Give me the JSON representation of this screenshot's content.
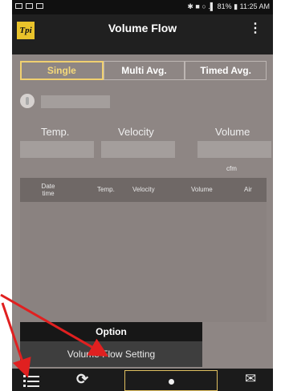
{
  "status_bar": {
    "time_text": "✱ ■ ○ .▌ 81% ▮ 11:25 AM"
  },
  "app_bar": {
    "logo": "Tpi",
    "title": "Volume Flow",
    "menu_icon": "more-vert-icon"
  },
  "tabs": [
    {
      "label": "Single",
      "active": true
    },
    {
      "label": "Multi Avg.",
      "active": false
    },
    {
      "label": "Timed Avg.",
      "active": false
    }
  ],
  "columns": {
    "temp_label": "Temp.",
    "velocity_label": "Velocity",
    "volume_label": "Volume",
    "volume_unit": "cfm"
  },
  "table": {
    "headers": [
      "Date time",
      "Temp.",
      "Velocity",
      "Volume",
      "Air"
    ]
  },
  "popup": {
    "title": "Option",
    "item": "Volume Flow Setting"
  },
  "bottom_bar": {
    "icons": [
      "list-icon",
      "refresh-icon",
      "record-icon",
      "mail-icon"
    ]
  },
  "colors": {
    "accent": "#f0d070",
    "background": "#8e8684",
    "annotation": "#e02020"
  }
}
